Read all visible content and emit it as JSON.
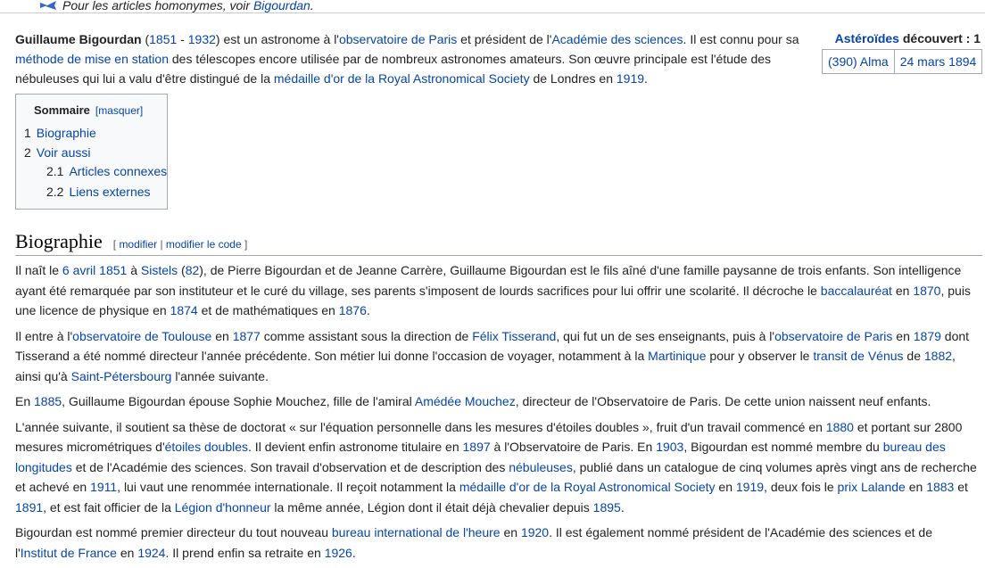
{
  "hatnote": {
    "icon": "disambiguation-icon",
    "text": "Pour les articles homonymes, voir ",
    "link": "Bigourdan",
    "suffix": "."
  },
  "lead": {
    "name": "Guillaume Bigourdan",
    "t1": " (",
    "year_birth": "1851",
    "t2": " - ",
    "year_death": "1932",
    "t3": ") est un astronome à l'",
    "l_obs_paris": "observatoire de Paris",
    "t4": " et président de l'",
    "l_academie": "Académie des sciences",
    "t5": ". Il est connu pour sa ",
    "l_methode": "méthode de mise en station",
    "t6": " des télescopes encore utilisée par de nombreux astronomes amateurs. Son œuvre principale est l'étude des nébuleuses qui lui a valu d'être distingué de la ",
    "l_medaille": "médaille d'or de la Royal Astronomical Society",
    "t7": " de Londres en ",
    "l_1919": "1919",
    "t8": "."
  },
  "infobox": {
    "title_link": "Astéroïdes",
    "title_rest": " découvert : 1",
    "asteroid": "(390) Alma",
    "date": "24 mars 1894"
  },
  "toc": {
    "title": "Sommaire",
    "toggle": "[masquer]",
    "items": [
      {
        "num": "1",
        "label": "Biographie"
      },
      {
        "num": "2",
        "label": "Voir aussi"
      },
      {
        "num": "2.1",
        "label": "Articles connexes"
      },
      {
        "num": "2.2",
        "label": "Liens externes"
      }
    ]
  },
  "section": {
    "title": "Biographie",
    "edit_open": "[ ",
    "edit_modifier": "modifier",
    "edit_sep": " | ",
    "edit_code": "modifier le code",
    "edit_close": " ]"
  },
  "p1": {
    "a": "Il naît le ",
    "l_date": "6 avril 1851",
    "b": " à ",
    "l_sistels": "Sistels",
    "c": " (",
    "l_82": "82",
    "d": "), de Pierre Bigourdan et de Jeanne Carrère, Guillaume Bigourdan est le fils aîné d'une famille paysanne de trois enfants. Son intelligence ayant été remarquée par son instituteur et le curé du village, ses parents s'imposent de lourds sacrifices pour lui offrir une scolarité. Il décroche le ",
    "l_bac": "baccalauréat",
    "e": " en ",
    "l_1870": "1870",
    "f": ", puis une licence de physique en ",
    "l_1874": "1874",
    "g": " et de mathématiques en ",
    "l_1876": "1876",
    "h": "."
  },
  "p2": {
    "a": "Il entre à l'",
    "l_obs_toulouse": "observatoire de Toulouse",
    "b": " en ",
    "l_1877": "1877",
    "c": " comme assistant sous la direction de ",
    "l_tisserand": "Félix Tisserand",
    "d": ", qui fut un de ses enseignants, puis à l'",
    "l_obs_paris": "observatoire de Paris",
    "e": " en ",
    "l_1879": "1879",
    "f": " dont Tisserand a été nommé directeur l'année précédente. Son métier lui donne l'occasion de voyager, notamment à la ",
    "l_martinique": "Martinique",
    "g": " pour y observer le ",
    "l_transit": "transit de Vénus",
    "h": " de ",
    "l_1882": "1882",
    "i": ", ainsi qu'à ",
    "l_stpete": "Saint-Pétersbourg",
    "j": " l'année suivante."
  },
  "p3": {
    "a": "En ",
    "l_1885": "1885",
    "b": ", Guillaume Bigourdan épouse Sophie Mouchez, fille de l'amiral ",
    "l_mouchez": "Amédée Mouchez",
    "c": ", directeur de l'Observatoire de Paris. De cette union naissent neuf enfants."
  },
  "p4": {
    "a": "L'année suivante, il soutient sa thèse de doctorat « sur l'équation personnelle dans les mesures d'étoiles doubles », fruit d'un travail commencé en ",
    "l_1880": "1880",
    "b": " et portant sur 2800 mesures micrométriques d'",
    "l_etoiles": "étoiles doubles",
    "c": ". Il devient enfin astronome titulaire en ",
    "l_1897": "1897",
    "d": " à l'Observatoire de Paris. En ",
    "l_1903": "1903",
    "e": ", Bigourdan est nommé membre du ",
    "l_bureau_long": "bureau des longitudes",
    "f": " et de l'Académie des sciences. Son travail d'observation et de description des ",
    "l_nebuleuses": "nébuleuses",
    "g": ", publié dans un catalogue de cinq volumes après vingt ans de recherche et achevé en ",
    "l_1911": "1911",
    "h": ", lui vaut une renommée internationale. Il reçoit notamment la ",
    "l_medaille": "médaille d'or de la Royal Astronomical Society",
    "i": " en ",
    "l_1919": "1919",
    "j": ", deux fois le ",
    "l_lalande": "prix Lalande",
    "k": " en ",
    "l_1883": "1883",
    "l": " et ",
    "l_1891": "1891",
    "m": ", et est fait officier de la ",
    "l_legion": "Légion d'honneur",
    "n": " la même année, Légion dont il était déjà chevalier depuis ",
    "l_1895": "1895",
    "o": "."
  },
  "p5": {
    "a": "Bigourdan est nommé premier directeur du tout nouveau ",
    "l_bih": "bureau international de l'heure",
    "b": " en ",
    "l_1920": "1920",
    "c": ". Il est également nommé président de l'Académie des sciences et de l'",
    "l_institut": "Institut de France",
    "d": " en ",
    "l_1924": "1924",
    "e": ". Il prend enfin sa retraite en ",
    "l_1926": "1926",
    "f": "."
  }
}
